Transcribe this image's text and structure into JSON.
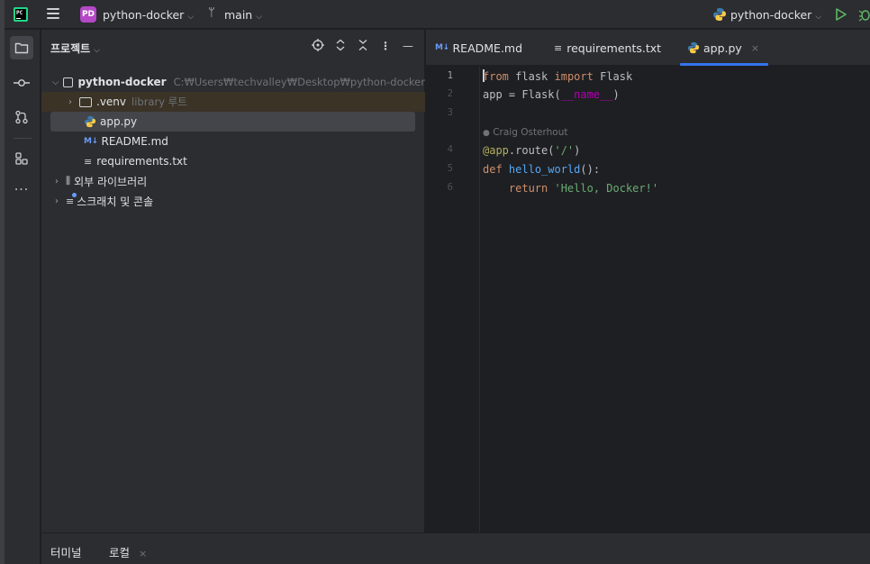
{
  "titlebar": {
    "app_logo": "PC",
    "project_badge": "PD",
    "project_name": "python-docker",
    "branch_name": "main",
    "run_config": "python-docker",
    "icons": [
      "pycharm-logo-icon",
      "hamburger-menu-icon",
      "branch-icon",
      "python-icon",
      "run-icon",
      "debug-icon"
    ]
  },
  "toolstrip": {
    "icons": [
      "folder-icon",
      "commit-icon",
      "pull-requests-icon",
      "structure-icon",
      "more-icon"
    ]
  },
  "project_panel": {
    "title": "프로젝트",
    "tree": {
      "root_name": "python-docker",
      "root_path": "C:₩Users₩techvalley₩Desktop₩python-docker",
      "venv_name": ".venv",
      "venv_hint": "library 루트",
      "files": [
        {
          "name": "app.py",
          "type": "python",
          "selected": true
        },
        {
          "name": "README.md",
          "type": "markdown",
          "icon_text": "M↓",
          "selected": false
        },
        {
          "name": "requirements.txt",
          "type": "text",
          "icon_text": "≡",
          "selected": false
        }
      ],
      "external_libs": "외부 라이브러리",
      "scratches": "스크래치 및 콘솔"
    }
  },
  "editor": {
    "tabs": [
      {
        "label": "README.md",
        "icon_text": "M↓"
      },
      {
        "label": "requirements.txt",
        "icon_text": "≡"
      },
      {
        "label": "app.py",
        "active": true,
        "close": "×"
      }
    ],
    "line_numbers": [
      "1",
      "2",
      "3",
      "4",
      "5",
      "6"
    ],
    "author_hint": "Craig Osterhout",
    "code_lines": [
      "from flask import Flask",
      "app = Flask(__name__)",
      "",
      "@app.route('/')",
      "def hello_world():",
      "    return 'Hello, Docker!'"
    ]
  },
  "bottom_bar": {
    "tabs": [
      {
        "label": "터미널"
      },
      {
        "label": "로컬",
        "close": "×"
      }
    ]
  },
  "colors": {
    "accent": "#3574f0",
    "keyword": "#cf8e6d",
    "string": "#6aab73",
    "decorator": "#b3ae60",
    "function": "#56a8f5",
    "dunder": "#b200b2",
    "badge": "#b548c6"
  }
}
